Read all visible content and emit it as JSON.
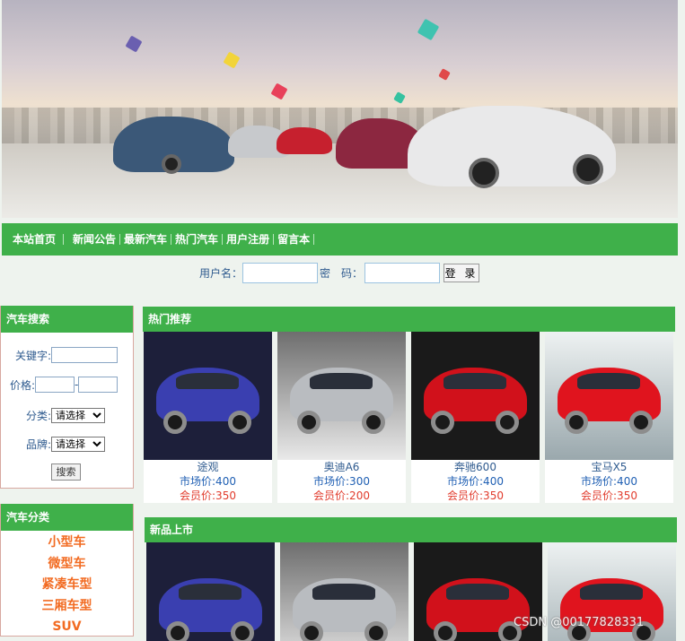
{
  "nav": {
    "items": [
      "本站首页",
      "新闻公告",
      "最新汽车",
      "热门汽车",
      "用户注册",
      "留言本"
    ]
  },
  "login": {
    "username_label": "用户名：",
    "password_label": "密　码：",
    "button_label": "登 录"
  },
  "search": {
    "title": "汽车搜索",
    "keyword_label": "关键字:",
    "price_label": "价格:",
    "price_sep": "-",
    "category_label": "分类:",
    "category_value": "请选择",
    "brand_label": "品牌:",
    "brand_value": "请选择",
    "button_label": "搜索"
  },
  "category": {
    "title": "汽车分类",
    "items": [
      "小型车",
      "微型车",
      "紧凑车型",
      "三厢车型",
      "SUV"
    ]
  },
  "hot": {
    "title": "热门推荐",
    "cars": [
      {
        "name": "途观",
        "market": "市场价:400",
        "member": "会员价:350",
        "color": "#3a3fb0",
        "bg": "#1d1f3a",
        "icon": "blue-hatchback-photo"
      },
      {
        "name": "奥迪A6",
        "market": "市场价:300",
        "member": "会员价:200",
        "color": "#b9bcc0",
        "bg": "#8d8d8d",
        "icon": "silver-sedan-photo"
      },
      {
        "name": "奔驰600",
        "market": "市场价:400",
        "member": "会员价:350",
        "color": "#d1111b",
        "bg": "#1a1a1a",
        "icon": "red-mercedes-photo"
      },
      {
        "name": "宝马X5",
        "market": "市场价:400",
        "member": "会员价:350",
        "color": "#e0141e",
        "bg": "#c9d3d6",
        "icon": "red-bmw-photo"
      }
    ]
  },
  "new": {
    "title": "新品上市",
    "cars": [
      {
        "color": "#3a3fb0",
        "bg": "#1d1f3a",
        "icon": "blue-hatchback-photo"
      },
      {
        "color": "#b9bcc0",
        "bg": "#8d8d8d",
        "icon": "silver-sedan-photo"
      },
      {
        "color": "#d1111b",
        "bg": "#1a1a1a",
        "icon": "red-mercedes-photo"
      },
      {
        "color": "#e0141e",
        "bg": "#c9d3d6",
        "icon": "red-bmw-photo"
      }
    ]
  },
  "watermark": "CSDN @00177828331",
  "colors": {
    "accent": "#3fb04a",
    "category_text": "#f26b22",
    "member_price": "#e13b2c",
    "market_price": "#1f5fb3"
  }
}
